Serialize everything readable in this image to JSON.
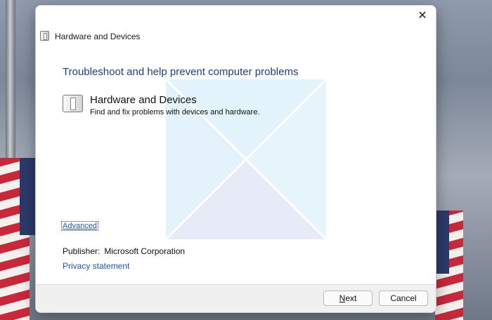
{
  "window": {
    "title": "Hardware and Devices",
    "close_glyph": "✕"
  },
  "main": {
    "heading": "Troubleshoot and help prevent computer problems",
    "item": {
      "icon": "hardware-device-icon",
      "title": "Hardware and Devices",
      "description": "Find and fix problems with devices and hardware."
    },
    "advanced_link": "Advanced",
    "publisher_label": "Publisher:",
    "publisher_value": "Microsoft Corporation",
    "privacy_link": "Privacy statement"
  },
  "footer": {
    "next_label_underlined": "N",
    "next_label_rest": "ext",
    "cancel_label": "Cancel"
  },
  "colors": {
    "heading": "#1c3f7a",
    "link": "#1a56b8",
    "footer_bg": "#f0f0f0"
  }
}
